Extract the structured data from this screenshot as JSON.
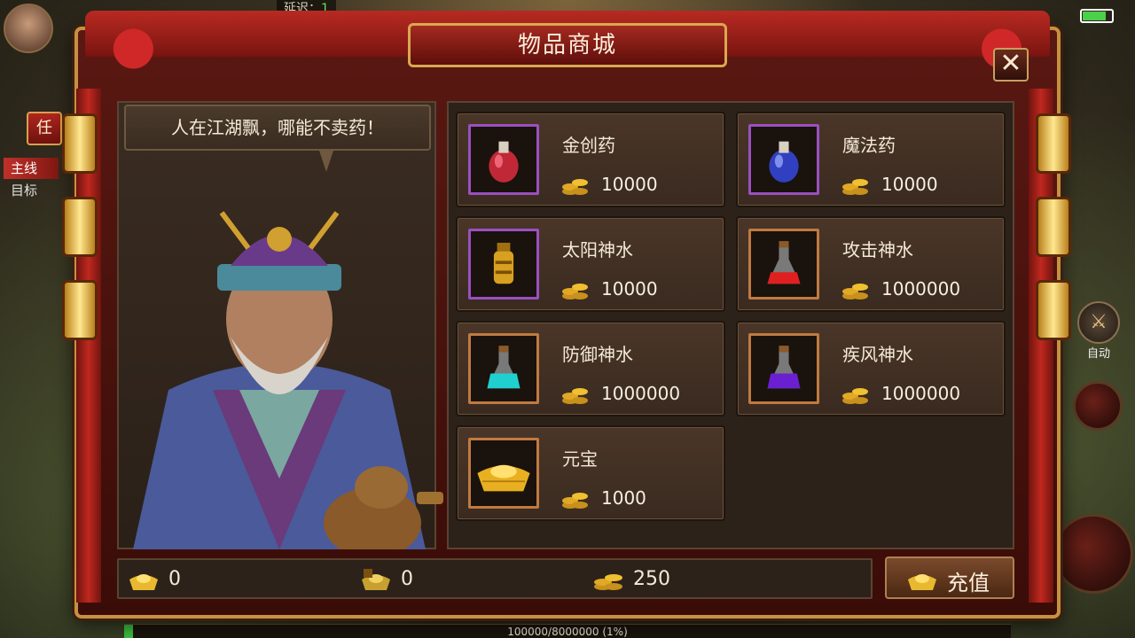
{
  "hud": {
    "player_name": "",
    "latency_label": "延迟：",
    "latency_value": "1",
    "quest_tab": "任",
    "main_line": "主线",
    "target": "目标",
    "auto_label": "自动",
    "exp_text": "100000/8000000 (1%)",
    "exp_fraction": 0.01
  },
  "shop": {
    "title": "物品商城",
    "close_label": "✕",
    "npc_speech": "人在江湖飘，哪能不卖药！",
    "items": [
      {
        "name": "金创药",
        "price": "10000",
        "rarity": "purple",
        "icon": "red-potion-icon"
      },
      {
        "name": "魔法药",
        "price": "10000",
        "rarity": "purple",
        "icon": "blue-potion-icon"
      },
      {
        "name": "太阳神水",
        "price": "10000",
        "rarity": "purple",
        "icon": "golden-lantern-potion-icon"
      },
      {
        "name": "攻击神水",
        "price": "1000000",
        "rarity": "orange",
        "icon": "red-flask-icon"
      },
      {
        "name": "防御神水",
        "price": "1000000",
        "rarity": "orange",
        "icon": "cyan-flask-icon"
      },
      {
        "name": "疾风神水",
        "price": "1000000",
        "rarity": "orange",
        "icon": "purple-flask-icon"
      },
      {
        "name": "元宝",
        "price": "1000",
        "rarity": "orange",
        "icon": "gold-ingot-icon"
      }
    ],
    "currency": {
      "ingot": "0",
      "bound_ingot": "0",
      "gold": "250"
    },
    "recharge_label": "充值"
  },
  "colors": {
    "frame_red": "#7a1410",
    "frame_gold": "#c89040",
    "rarity_purple": "#9a50c0",
    "rarity_orange": "#c07a40"
  }
}
